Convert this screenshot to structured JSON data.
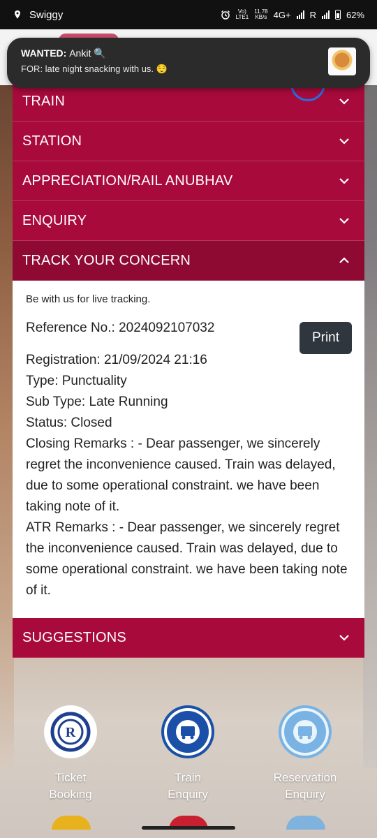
{
  "status_bar": {
    "app": "Swiggy",
    "net_speed": "11.78",
    "net_unit": "KB/s",
    "volte": "Vo)",
    "lte": "LTE1",
    "network": "4G+",
    "roaming": "R",
    "battery": "62%"
  },
  "notification": {
    "title_prefix": "WANTED: ",
    "title_name": "Ankit",
    "title_emoji": "🔍",
    "body": "FOR: late night snacking with us. 😌"
  },
  "accordion": {
    "items": [
      {
        "label": "TRAIN",
        "state": "collapsed"
      },
      {
        "label": "STATION",
        "state": "collapsed"
      },
      {
        "label": "APPRECIATION/RAIL ANUBHAV",
        "state": "collapsed"
      },
      {
        "label": "ENQUIRY",
        "state": "collapsed"
      },
      {
        "label": "TRACK YOUR CONCERN",
        "state": "expanded"
      },
      {
        "label": "SUGGESTIONS",
        "state": "collapsed"
      }
    ]
  },
  "concern": {
    "live_text": "Be with us for live tracking.",
    "reference": "Reference No.: 2024092107032",
    "print_label": "Print",
    "registration": "Registration: 21/09/2024 21:16",
    "type": "Type: Punctuality",
    "sub_type": "Sub Type: Late Running",
    "status": "Status: Closed",
    "closing_remarks": "Closing Remarks : - Dear passenger, we sincerely regret the inconvenience caused. Train was delayed, due to some operational constraint. we have been taking note of it.",
    "atr_remarks": "ATR Remarks : - Dear passenger, we sincerely regret the inconvenience caused. Train was delayed, due to some operational constraint. we have been taking note of it."
  },
  "quick_links": [
    {
      "label": "Ticket\nBooking",
      "icon": "irctc-logo-icon"
    },
    {
      "label": "Train\nEnquiry",
      "icon": "indian-railways-emblem-icon"
    },
    {
      "label": "Reservation\nEnquiry",
      "icon": "indian-railways-emblem-icon"
    }
  ],
  "colors": {
    "accordion_bg": "#a80a3c",
    "accordion_active_bg": "#8e0a33",
    "print_button_bg": "#2f363d",
    "notification_bg": "#2b2b2b"
  }
}
